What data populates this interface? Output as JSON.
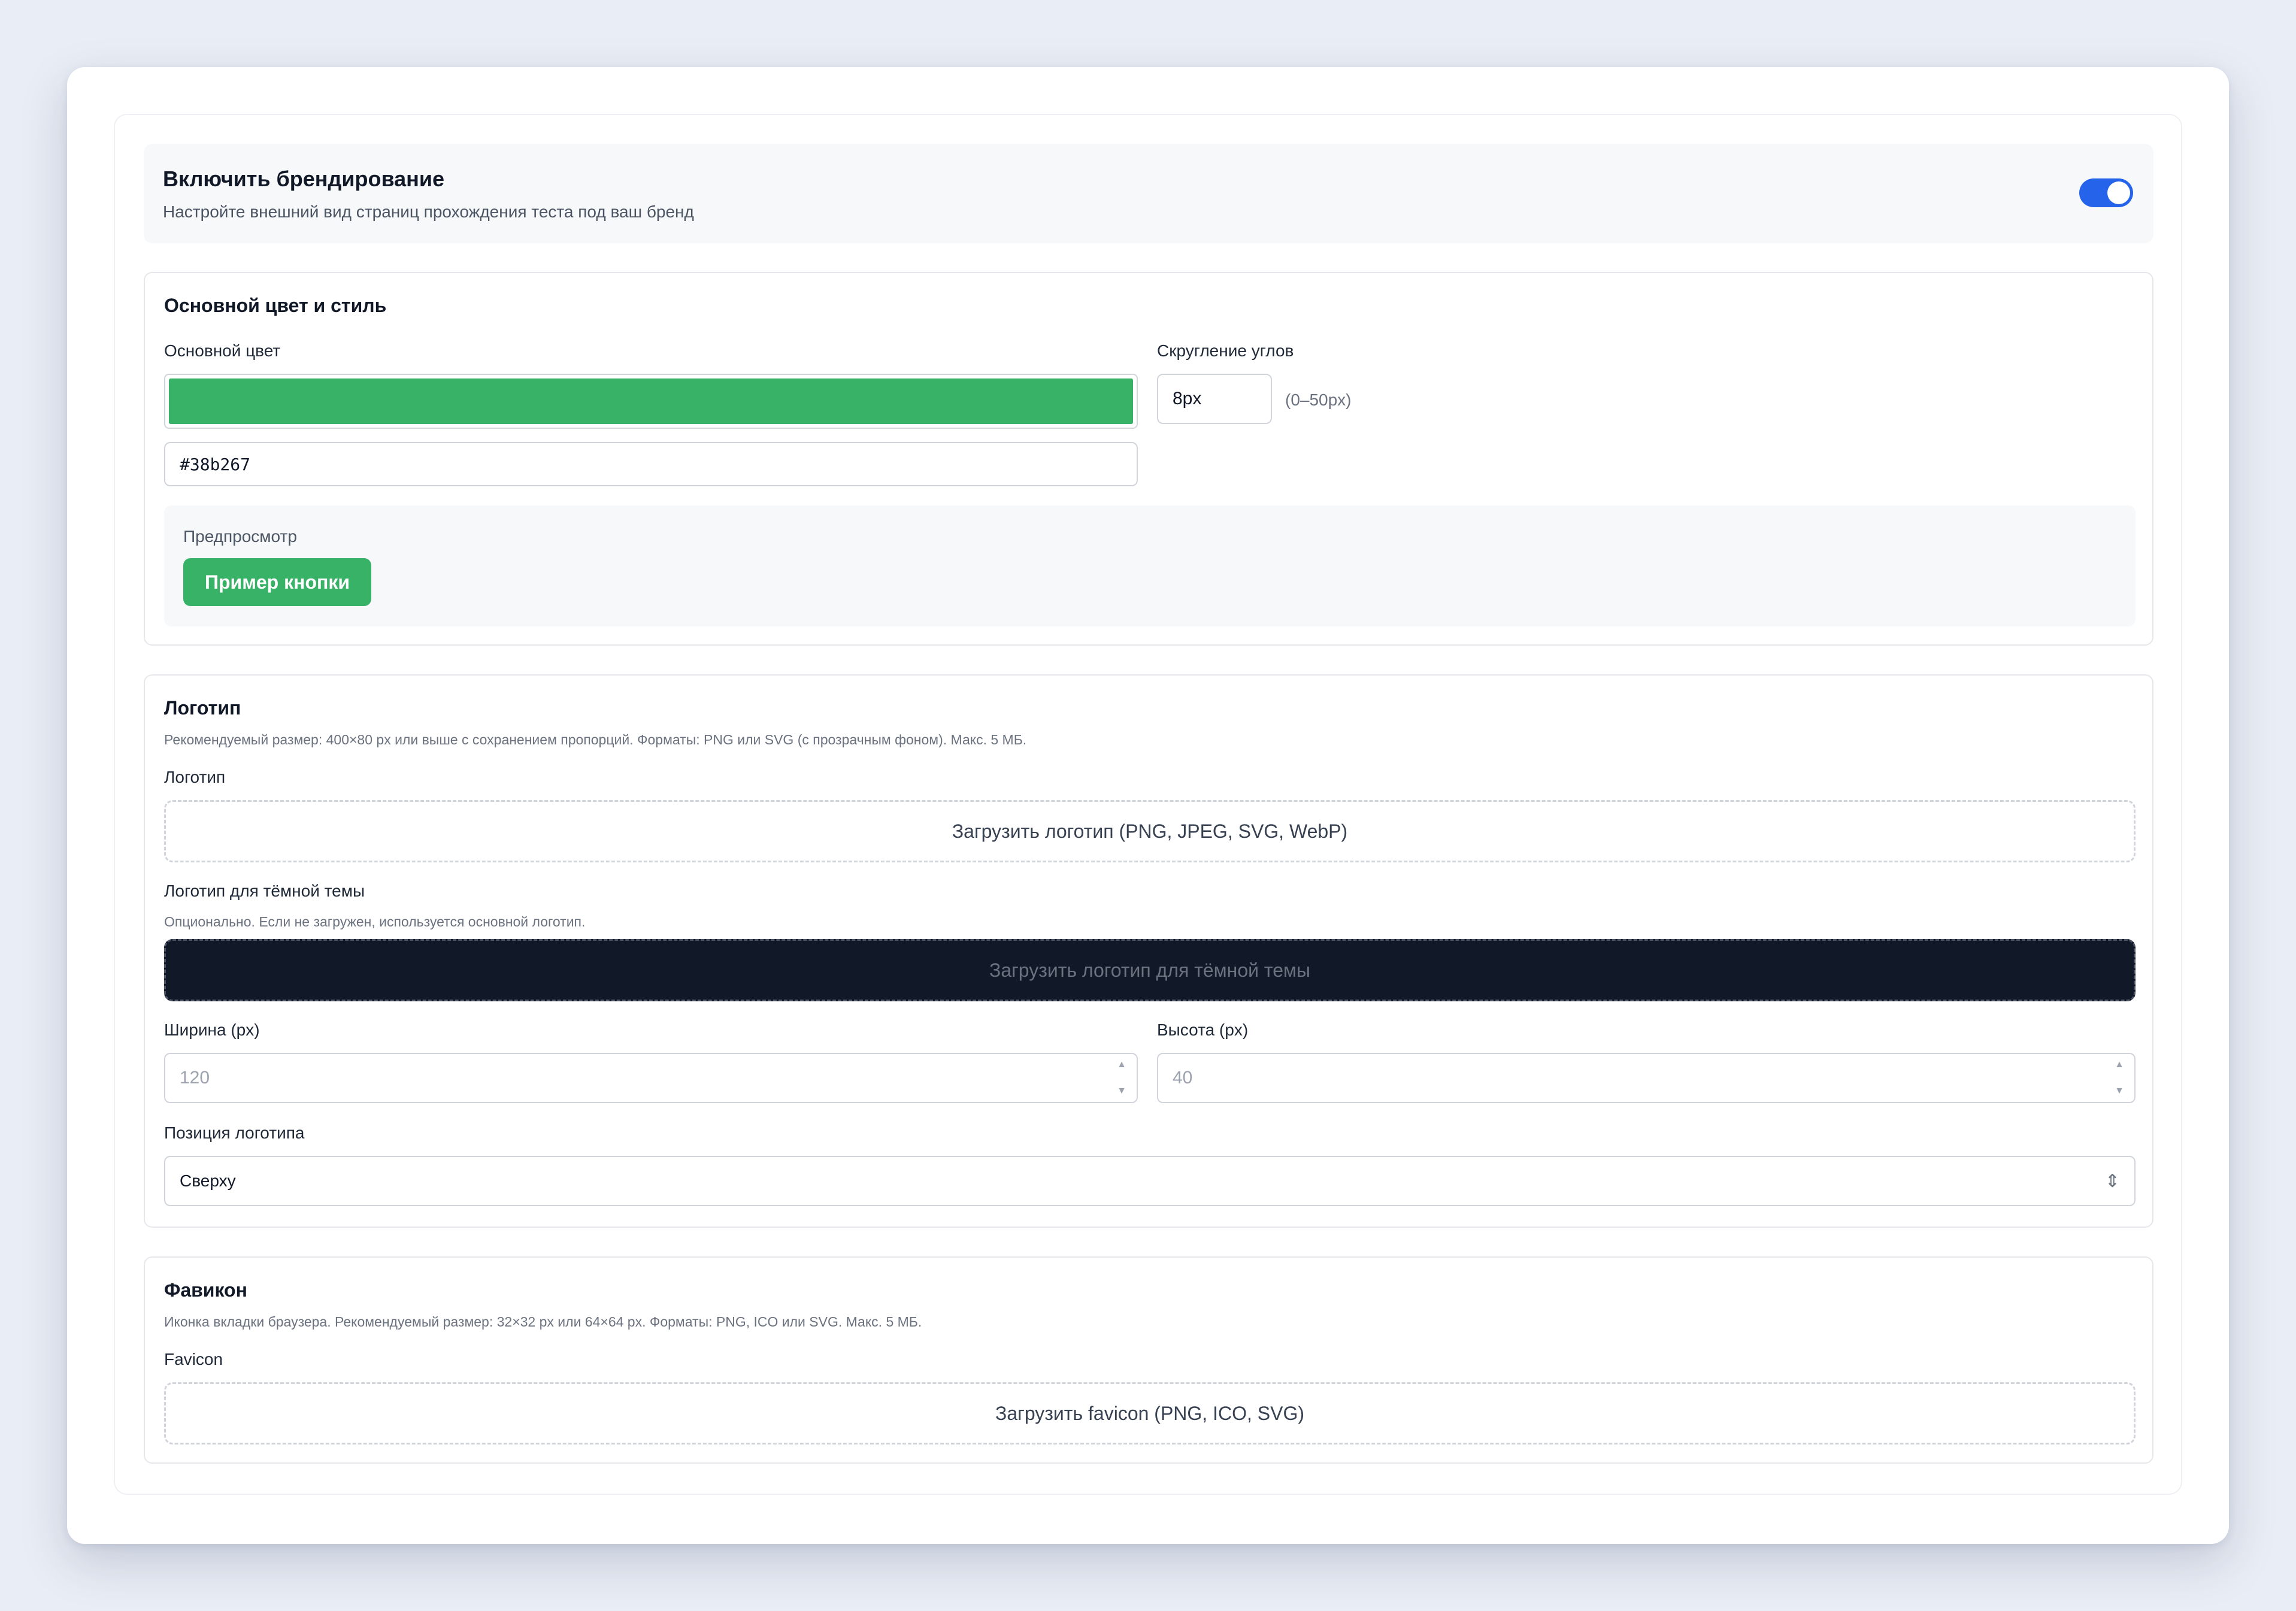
{
  "branding": {
    "title": "Включить брендирование",
    "description": "Настройте внешний вид страниц прохождения теста под ваш бренд",
    "enabled": true
  },
  "style_section": {
    "title": "Основной цвет и стиль",
    "color_label": "Основной цвет",
    "color_value": "#38b267",
    "radius_label": "Скругление углов",
    "radius_value": "8px",
    "radius_hint": "(0–50px)",
    "preview_label": "Предпросмотр",
    "preview_button": "Пример кнопки"
  },
  "logo_section": {
    "title": "Логотип",
    "description": "Рекомендуемый размер: 400×80 px или выше с сохранением пропорций. Форматы: PNG или SVG (с прозрачным фоном). Макс. 5 МБ.",
    "logo_label": "Логотип",
    "logo_upload": "Загрузить логотип (PNG, JPEG, SVG, WebP)",
    "dark_label": "Логотип для тёмной темы",
    "dark_hint": "Опционально. Если не загружен, используется основной логотип.",
    "dark_upload": "Загрузить логотип для тёмной темы",
    "width_label": "Ширина (px)",
    "width_placeholder": "120",
    "height_label": "Высота (px)",
    "height_placeholder": "40",
    "position_label": "Позиция логотипа",
    "position_value": "Сверху"
  },
  "favicon_section": {
    "title": "Фавикон",
    "description": "Иконка вкладки браузера. Рекомендуемый размер: 32×32 px или 64×64 px. Форматы: PNG, ICO или SVG. Макс. 5 МБ.",
    "label": "Favicon",
    "upload": "Загрузить favicon (PNG, ICO, SVG)"
  },
  "colors": {
    "accent_green": "#38b267",
    "toggle_blue": "#2563eb",
    "dark_upload_bg": "#111827"
  },
  "icons": {
    "spinner_up": "▲",
    "spinner_down": "▼",
    "select_arrows": "⇕"
  }
}
